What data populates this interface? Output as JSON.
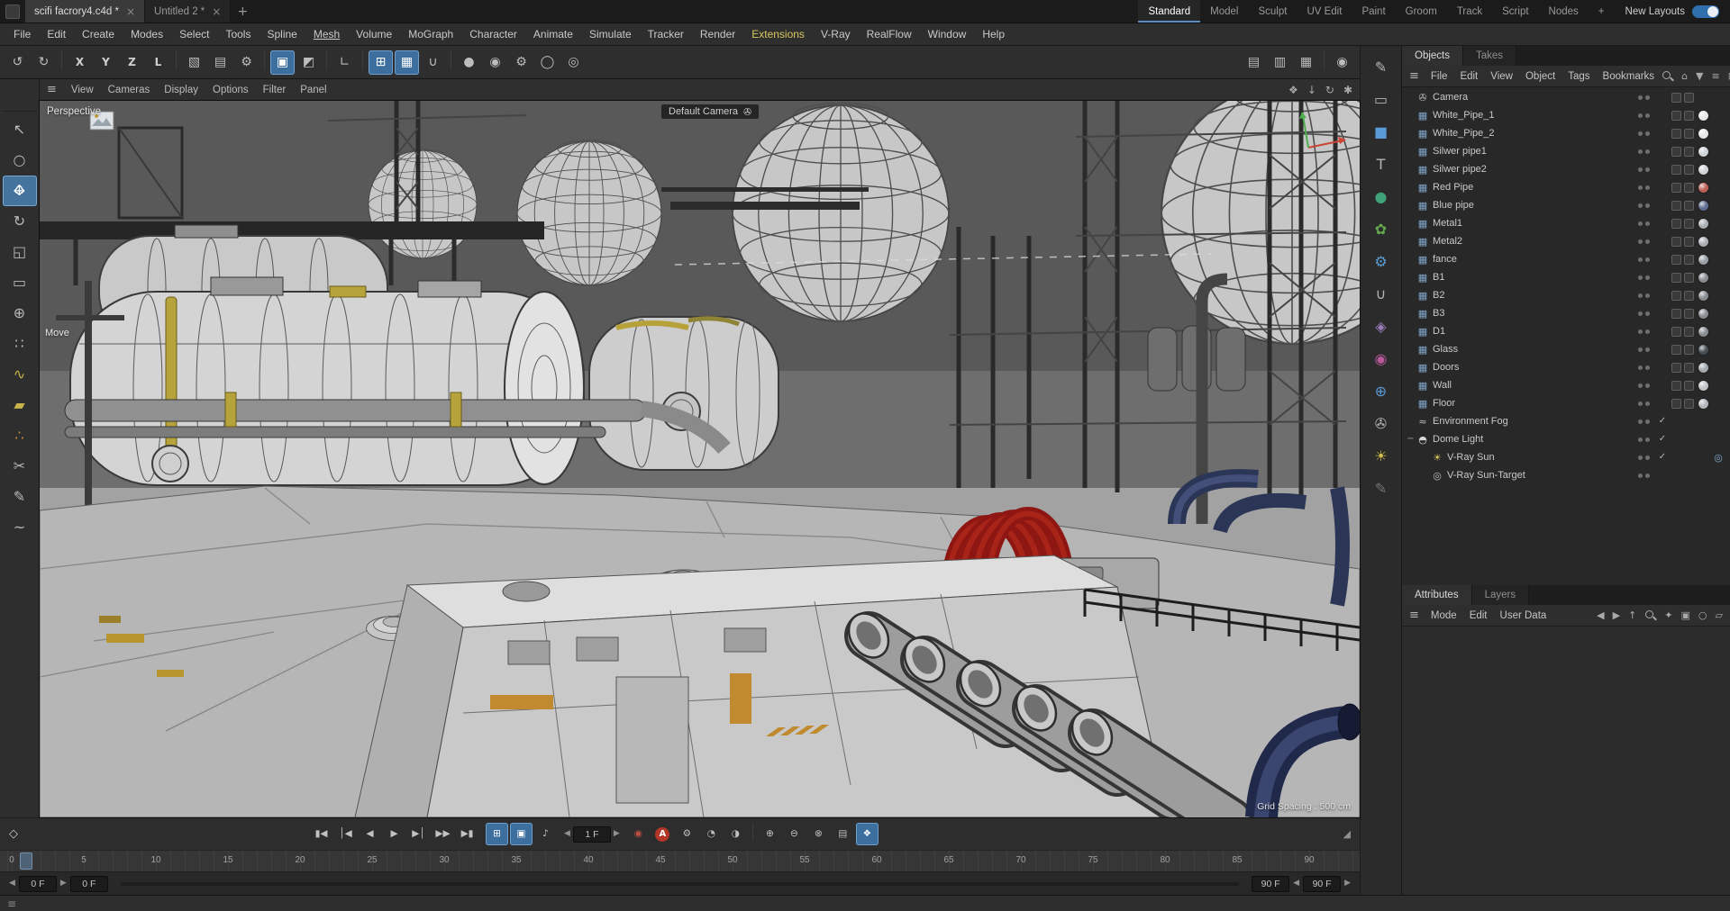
{
  "titlebar": {
    "doc_tabs": [
      {
        "label": "scifi facrory4.c4d *",
        "close": "×",
        "active": true
      },
      {
        "label": "Untitled 2 *",
        "close": "×"
      }
    ],
    "new_tab_label": "+",
    "layout_tabs": [
      {
        "label": "Standard",
        "active": true
      },
      {
        "label": "Model"
      },
      {
        "label": "Sculpt"
      },
      {
        "label": "UV Edit"
      },
      {
        "label": "Paint"
      },
      {
        "label": "Groom"
      },
      {
        "label": "Track"
      },
      {
        "label": "Script"
      },
      {
        "label": "Nodes"
      },
      {
        "label": "+"
      }
    ],
    "new_layouts_label": "New Layouts",
    "toggle_on": true
  },
  "menubar": {
    "items": [
      {
        "label": "File"
      },
      {
        "label": "Edit"
      },
      {
        "label": "Create"
      },
      {
        "label": "Modes"
      },
      {
        "label": "Select"
      },
      {
        "label": "Tools"
      },
      {
        "label": "Spline"
      },
      {
        "label": "Mesh",
        "cls": "sel"
      },
      {
        "label": "Volume"
      },
      {
        "label": "MoGraph"
      },
      {
        "label": "Character"
      },
      {
        "label": "Animate"
      },
      {
        "label": "Simulate"
      },
      {
        "label": "Tracker"
      },
      {
        "label": "Render"
      },
      {
        "label": "Extensions",
        "cls": "accent"
      },
      {
        "label": "V-Ray"
      },
      {
        "label": "RealFlow"
      },
      {
        "label": "Window"
      },
      {
        "label": "Help"
      }
    ]
  },
  "toolbar": {
    "items": [
      {
        "name": "undo-icon",
        "g": "↺"
      },
      {
        "name": "redo-icon",
        "g": "↻"
      },
      {
        "name": "separator",
        "cls": "sep"
      },
      {
        "name": "axis-x-button",
        "g": "X",
        "cls": "axisbtn"
      },
      {
        "name": "axis-y-button",
        "g": "Y",
        "cls": "axisbtn"
      },
      {
        "name": "axis-z-button",
        "g": "Z",
        "cls": "axisbtn"
      },
      {
        "name": "coord-system-button",
        "g": "L",
        "cls": "axisbtn"
      },
      {
        "name": "separator",
        "cls": "sep"
      },
      {
        "name": "render-view-icon",
        "g": "▧"
      },
      {
        "name": "render-picture-viewer-icon",
        "g": "▤"
      },
      {
        "name": "render-settings-icon",
        "g": "⚙"
      },
      {
        "name": "separator",
        "cls": "sep"
      },
      {
        "name": "perspective-mode-icon",
        "g": "▣",
        "cls": "active"
      },
      {
        "name": "isoparm-mode-icon",
        "g": "◩"
      },
      {
        "name": "separator",
        "cls": "sep"
      },
      {
        "name": "workplane-icon",
        "g": "∟"
      },
      {
        "name": "separator",
        "cls": "sep"
      },
      {
        "name": "snap-toggle-icon",
        "g": "⊞",
        "cls": "active"
      },
      {
        "name": "grid-snap-icon",
        "g": "▦",
        "cls": "active"
      },
      {
        "name": "magnet-snap-icon",
        "g": "∪"
      },
      {
        "name": "separator",
        "cls": "sep"
      },
      {
        "name": "simulation-icon",
        "g": "●"
      },
      {
        "name": "gravity-icon",
        "g": "◉"
      },
      {
        "name": "settings-gear-icon",
        "g": "⚙"
      },
      {
        "name": "cloth-icon",
        "g": "◯"
      },
      {
        "name": "volume-builder-icon",
        "g": "◎"
      }
    ],
    "right_items": [
      {
        "name": "layout-single-icon",
        "g": "▤"
      },
      {
        "name": "layout-split-icon",
        "g": "▥"
      },
      {
        "name": "layout-quad-icon",
        "g": "▦"
      },
      {
        "name": "separator",
        "cls": "sep"
      },
      {
        "name": "material-preview-icon",
        "g": "◉"
      }
    ]
  },
  "left_tools": {
    "items": [
      {
        "name": "search-icon",
        "cls": "mag"
      },
      {
        "name": "select-tool-icon",
        "g": "↖"
      },
      {
        "name": "lasso-select-icon",
        "g": "○"
      },
      {
        "name": "move-tool-icon",
        "g": "",
        "cls": "move active"
      },
      {
        "name": "rotate-tool-icon",
        "g": "↻"
      },
      {
        "name": "scale-tool-icon",
        "g": "◱"
      },
      {
        "name": "frame-tool-icon",
        "g": "▭"
      },
      {
        "name": "axis-tool-icon",
        "g": "⊕"
      },
      {
        "name": "points-mode-icon",
        "g": "∷"
      },
      {
        "name": "edges-mode-icon",
        "g": "∿",
        "color": "#c9b44a"
      },
      {
        "name": "polygons-mode-icon",
        "g": "▰",
        "color": "#c9b44a"
      },
      {
        "name": "vertex-paint-icon",
        "g": "∴",
        "color": "#cf8a3a"
      },
      {
        "name": "knife-tool-icon",
        "g": "✂"
      },
      {
        "name": "pen-tool-icon",
        "g": "✎"
      },
      {
        "name": "spline-tool-icon",
        "g": "~"
      }
    ]
  },
  "viewport": {
    "menu_toggle_glyph": "≡",
    "menu": [
      {
        "label": "View"
      },
      {
        "label": "Cameras"
      },
      {
        "label": "Display"
      },
      {
        "label": "Options"
      },
      {
        "label": "Filter"
      },
      {
        "label": "Panel"
      }
    ],
    "right_icons": [
      {
        "name": "pan-hand-icon",
        "g": "❖"
      },
      {
        "name": "frame-geometry-icon",
        "g": "↓"
      },
      {
        "name": "refresh-icon",
        "g": "↻"
      },
      {
        "name": "view-options-icon",
        "g": "✱"
      }
    ],
    "view_label": "Perspective",
    "camera_label": "Default Camera",
    "camera_icon_glyph": "✇",
    "tool_hint": "Move",
    "grid_spacing": "Grid Spacing : 500 cm"
  },
  "right_tools": {
    "items": [
      {
        "name": "sculpt-pen-icon",
        "g": "✎"
      },
      {
        "name": "plane-icon",
        "g": "▭"
      },
      {
        "name": "cube-icon",
        "g": "■",
        "color": "#5b9bd5"
      },
      {
        "name": "text-tool-icon",
        "g": "T"
      },
      {
        "name": "sphere-icon",
        "g": "●",
        "color": "#3fa37a"
      },
      {
        "name": "tree-icon",
        "g": "✿",
        "color": "#63a84e"
      },
      {
        "name": "gear-icon",
        "g": "⚙",
        "color": "#5b9bd5"
      },
      {
        "name": "snap-magnet-icon",
        "g": "∪"
      },
      {
        "name": "deformer-icon",
        "g": "◈",
        "color": "#9a7ab8"
      },
      {
        "name": "volume-icon",
        "g": "◉",
        "color": "#b85a9a"
      },
      {
        "name": "globe-icon",
        "g": "⊕",
        "color": "#5b9bd5"
      },
      {
        "name": "camera-icon",
        "g": "✇"
      },
      {
        "name": "light-icon",
        "g": "☀",
        "color": "#d2bd4e"
      },
      {
        "name": "brush-icon",
        "g": "✎",
        "color": "#757575"
      }
    ]
  },
  "object_manager": {
    "tabs": [
      {
        "label": "Objects",
        "active": true
      },
      {
        "label": "Takes"
      }
    ],
    "menu_toggle_glyph": "≡",
    "menu_items": [
      {
        "label": "File"
      },
      {
        "label": "Edit"
      },
      {
        "label": "View"
      },
      {
        "label": "Object"
      },
      {
        "label": "Tags"
      },
      {
        "label": "Bookmarks"
      }
    ],
    "icons": {
      "home": "⌂",
      "filter": "▼",
      "list": "≡",
      "grid": "⊞"
    },
    "items": [
      {
        "label": "Camera",
        "icon": "✇",
        "icolor": "#bdbdbd",
        "t": true
      },
      {
        "label": "White_Pipe_1",
        "icon": "▦",
        "icolor": "#7fa6c9",
        "t": true,
        "mat": "#e6e6e6"
      },
      {
        "label": "White_Pipe_2",
        "icon": "▦",
        "icolor": "#7fa6c9",
        "t": true,
        "mat": "#e6e6e6"
      },
      {
        "label": "Silwer pipe1",
        "icon": "▦",
        "icolor": "#7fa6c9",
        "t": true,
        "mat": "#cdd2d6"
      },
      {
        "label": "Silwer pipe2",
        "icon": "▦",
        "icolor": "#7fa6c9",
        "t": true,
        "mat": "#cdd2d6"
      },
      {
        "label": "Red Pipe",
        "icon": "▦",
        "icolor": "#7fa6c9",
        "t": true,
        "mat": "#bb6158"
      },
      {
        "label": "Blue pipe",
        "icon": "▦",
        "icolor": "#7fa6c9",
        "t": true,
        "mat": "#5f6d92"
      },
      {
        "label": "Metal1",
        "icon": "▦",
        "icolor": "#7fa6c9",
        "t": true,
        "mat": "#a9aeb3"
      },
      {
        "label": "Metal2",
        "icon": "▦",
        "icolor": "#7fa6c9",
        "t": true,
        "mat": "#a9aeb3"
      },
      {
        "label": "fance",
        "icon": "▦",
        "icolor": "#7fa6c9",
        "t": true,
        "mat": "#979da3"
      },
      {
        "label": "B1",
        "icon": "▦",
        "icolor": "#7fa6c9",
        "t": true,
        "mat": "#878c91"
      },
      {
        "label": "B2",
        "icon": "▦",
        "icolor": "#7fa6c9",
        "t": true,
        "mat": "#878c91"
      },
      {
        "label": "B3",
        "icon": "▦",
        "icolor": "#7fa6c9",
        "t": true,
        "mat": "#878c91"
      },
      {
        "label": "D1",
        "icon": "▦",
        "icolor": "#7fa6c9",
        "t": true,
        "mat": "#878c91"
      },
      {
        "label": "Glass",
        "icon": "▦",
        "icolor": "#7fa6c9",
        "t": true,
        "mat": "#474f56"
      },
      {
        "label": "Doors",
        "icon": "▦",
        "icolor": "#7fa6c9",
        "t": true,
        "mat": "#a3a8ad"
      },
      {
        "label": "Wall",
        "icon": "▦",
        "icolor": "#7fa6c9",
        "t": true,
        "mat": "#bfc3c7"
      },
      {
        "label": "Floor",
        "icon": "▦",
        "icolor": "#7fa6c9",
        "t": true,
        "mat": "#b2b6ba"
      },
      {
        "label": "Environment Fog",
        "icon": "≈",
        "icolor": "#bdbdbd",
        "check": true
      },
      {
        "label": "Dome Light",
        "icon": "◓",
        "icolor": "#d8d8d8",
        "expander": true,
        "check": true
      },
      {
        "label": "V-Ray Sun",
        "icon": "☀",
        "icolor": "#d6c35a",
        "indent": 1,
        "check": true,
        "target": true
      },
      {
        "label": "V-Ray Sun-Target",
        "icon": "◎",
        "icolor": "#bdbdbd",
        "indent": 1
      }
    ]
  },
  "attributes": {
    "tabs": [
      {
        "label": "Attributes",
        "active": true
      },
      {
        "label": "Layers"
      }
    ],
    "menu_toggle_glyph": "≡",
    "menu_items": [
      {
        "label": "Mode"
      },
      {
        "label": "Edit"
      },
      {
        "label": "User Data"
      }
    ],
    "icons": {
      "back": "◀",
      "forward": "▶",
      "up": "↑",
      "key": "✦",
      "lock": "▣",
      "state": "○",
      "expand": "▱"
    }
  },
  "timeline": {
    "key_glyph": "◇",
    "transport": [
      {
        "name": "goto-start-button",
        "g": "▮◀"
      },
      {
        "name": "prev-key-button",
        "g": "│◀"
      },
      {
        "name": "prev-frame-button",
        "g": "◀"
      },
      {
        "name": "play-button",
        "g": "▶"
      },
      {
        "name": "next-frame-button",
        "g": "▶│"
      },
      {
        "name": "next-key-button",
        "g": "▶▶"
      },
      {
        "name": "goto-end-button",
        "g": "▶▮"
      }
    ],
    "toggles": [
      {
        "name": "keyframe-selection-toggle",
        "g": "⊞",
        "cls": "active"
      },
      {
        "name": "autokey-selection-toggle",
        "g": "▣",
        "cls": "active"
      },
      {
        "name": "sound-toggle",
        "g": "♪"
      }
    ],
    "stepper_left": "◀",
    "stepper_right": "▶",
    "frame_value": "1 F",
    "after_icons": [
      {
        "name": "record-button",
        "g": "◉",
        "color": "#c05040"
      },
      {
        "name": "autokey-button",
        "g": "A",
        "cls": "autokey"
      },
      {
        "name": "keyframe-settings-icon",
        "g": "⚙"
      },
      {
        "name": "playback-rate-icon",
        "g": "◔"
      },
      {
        "name": "hud-icon",
        "g": "◑"
      },
      {
        "name": "separator",
        "cls": "sep"
      },
      {
        "name": "key-position-icon",
        "g": "⊕"
      },
      {
        "name": "key-scale-icon",
        "g": "⊖"
      },
      {
        "name": "key-rotation-icon",
        "g": "⊗"
      },
      {
        "name": "key-parameter-icon",
        "g": "▤"
      },
      {
        "name": "pla-icon",
        "g": "❖",
        "cls": "active"
      }
    ],
    "resize_glyph": "◢",
    "ruler": [
      {
        "n": "0"
      },
      {
        "n": "5"
      },
      {
        "n": "10"
      },
      {
        "n": "15"
      },
      {
        "n": "20"
      },
      {
        "n": "25"
      },
      {
        "n": "30"
      },
      {
        "n": "35"
      },
      {
        "n": "40"
      },
      {
        "n": "45"
      },
      {
        "n": "50"
      },
      {
        "n": "55"
      },
      {
        "n": "60"
      },
      {
        "n": "65"
      },
      {
        "n": "70"
      },
      {
        "n": "75"
      },
      {
        "n": "80"
      },
      {
        "n": "85"
      },
      {
        "n": "90"
      }
    ],
    "range": {
      "start": "0 F",
      "current": "0 F",
      "end": "90 F",
      "end2": "90 F"
    }
  },
  "statusbar": {
    "menu_glyph": "≡"
  }
}
